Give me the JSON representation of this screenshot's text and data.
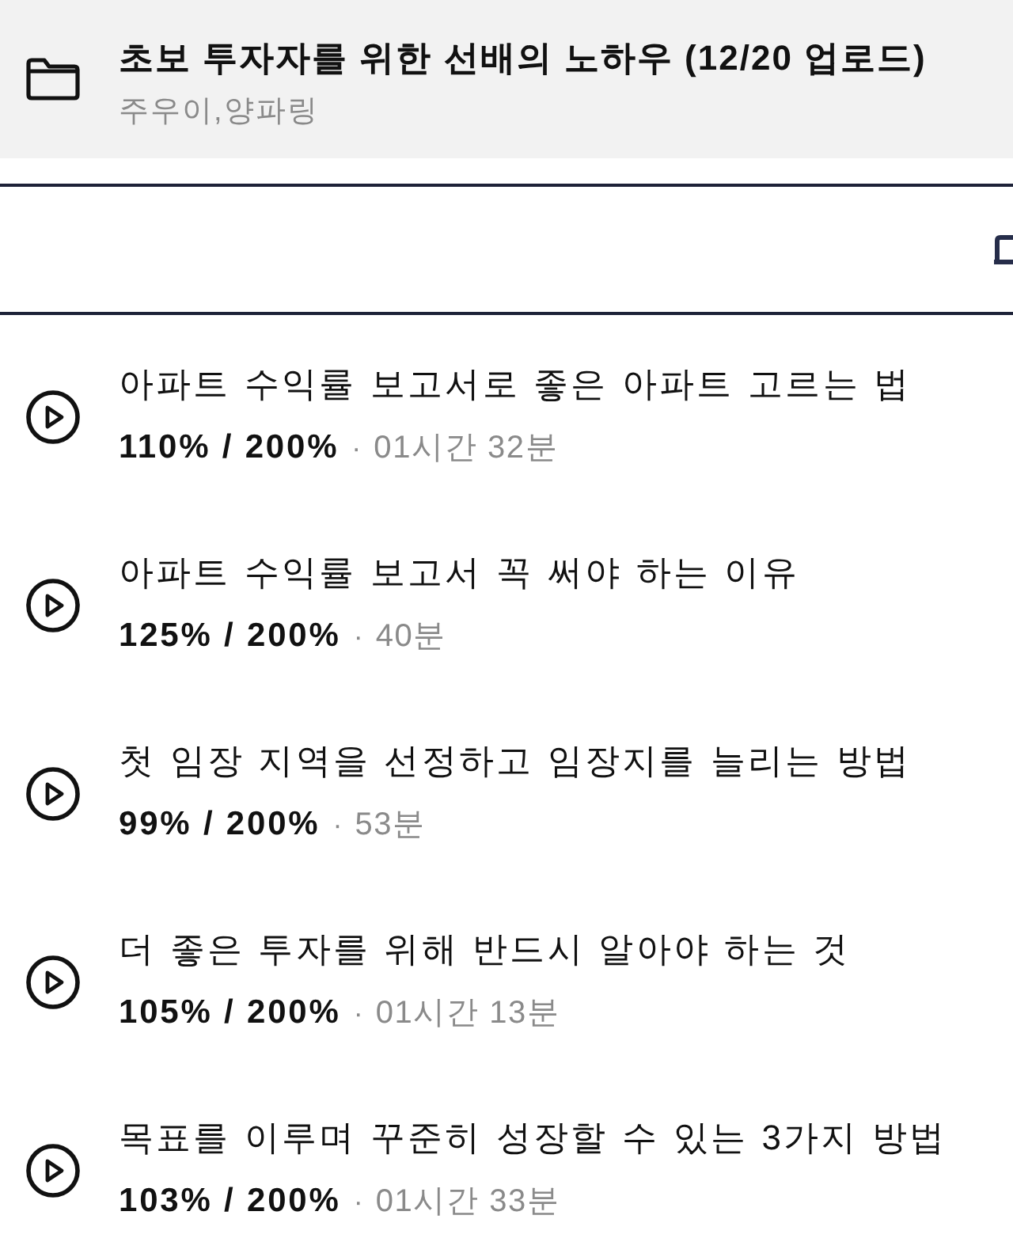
{
  "folder": {
    "title": "초보 투자자를 위한 선배의 노하우 (12/20 업로드)",
    "authors": "주우이,양파링"
  },
  "lectures": [
    {
      "title": "아파트 수익률 보고서로 좋은 아파트 고르는 법",
      "progress": "110% / 200%",
      "separator": "·",
      "duration": "01시간 32분"
    },
    {
      "title": "아파트 수익률 보고서 꼭 써야 하는 이유",
      "progress": "125% / 200%",
      "separator": "·",
      "duration": "40분"
    },
    {
      "title": "첫 임장 지역을 선정하고 임장지를 늘리는 방법",
      "progress": "99% / 200%",
      "separator": "·",
      "duration": "53분"
    },
    {
      "title": "더 좋은 투자를 위해 반드시 알아야 하는 것",
      "progress": "105% / 200%",
      "separator": "·",
      "duration": "01시간 13분"
    },
    {
      "title": "목표를 이루며 꾸준히 성장할 수 있는 3가지 방법",
      "progress": "103% / 200%",
      "separator": "·",
      "duration": "01시간 33분"
    }
  ]
}
